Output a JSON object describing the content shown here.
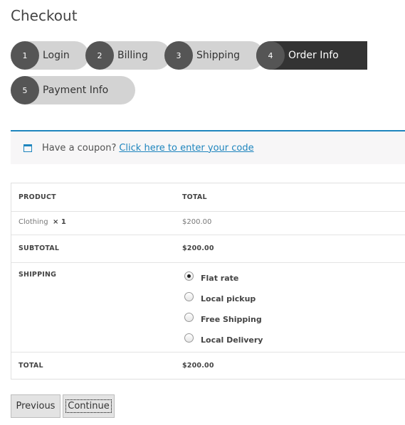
{
  "page": {
    "title": "Checkout"
  },
  "steps": [
    {
      "num": "1",
      "label": "Login"
    },
    {
      "num": "2",
      "label": "Billing"
    },
    {
      "num": "3",
      "label": "Shipping"
    },
    {
      "num": "4",
      "label": "Order Info"
    },
    {
      "num": "5",
      "label": "Payment Info"
    }
  ],
  "coupon": {
    "prompt": "Have a coupon?",
    "link": "Click here to enter your code"
  },
  "order": {
    "headers": {
      "product": "PRODUCT",
      "total": "TOTAL"
    },
    "item": {
      "name": "Clothing",
      "qty": "× 1",
      "total": "$200.00"
    },
    "subtotal": {
      "label": "SUBTOTAL",
      "value": "$200.00"
    },
    "shipping": {
      "label": "SHIPPING",
      "options": [
        "Flat rate",
        "Local pickup",
        "Free Shipping",
        "Local Delivery"
      ],
      "selected": "Flat rate"
    },
    "total": {
      "label": "TOTAL",
      "value": "$200.00"
    }
  },
  "buttons": {
    "previous": "Previous",
    "continue": "Continue"
  },
  "colors": {
    "accent": "#1e85be",
    "step_active": "#333333",
    "step_inactive": "#d3d3d3"
  }
}
